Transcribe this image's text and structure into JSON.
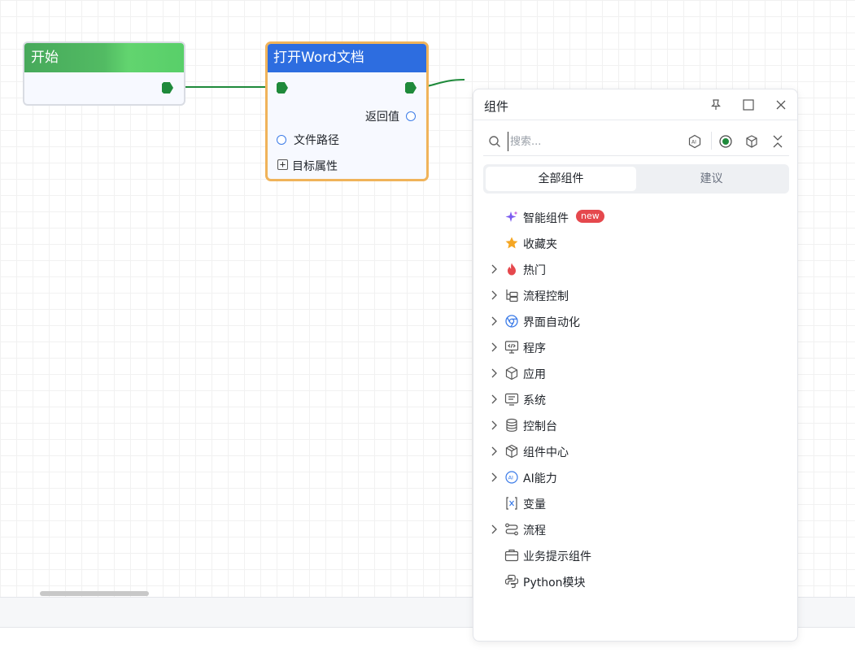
{
  "canvas": {
    "nodes": [
      {
        "title": "开始"
      },
      {
        "title": "打开Word文档",
        "output_label": "返回值",
        "input_label": "文件路径",
        "expand_label": "目标属性"
      }
    ]
  },
  "panel": {
    "title": "组件",
    "search": {
      "placeholder": "搜索..."
    },
    "tabs": [
      {
        "label": "全部组件",
        "active": true
      },
      {
        "label": "建议",
        "active": false
      }
    ],
    "tree": [
      {
        "label": "智能组件",
        "icon": "sparkle-icon",
        "expandable": false,
        "badge": "new"
      },
      {
        "label": "收藏夹",
        "icon": "star-icon",
        "expandable": false
      },
      {
        "label": "热门",
        "icon": "fire-icon",
        "expandable": true
      },
      {
        "label": "流程控制",
        "icon": "flow-control-icon",
        "expandable": true
      },
      {
        "label": "界面自动化",
        "icon": "browser-automation-icon",
        "expandable": true
      },
      {
        "label": "程序",
        "icon": "program-monitor-icon",
        "expandable": true
      },
      {
        "label": "应用",
        "icon": "cube-icon",
        "expandable": true
      },
      {
        "label": "系统",
        "icon": "system-icon",
        "expandable": true
      },
      {
        "label": "控制台",
        "icon": "database-icon",
        "expandable": true
      },
      {
        "label": "组件中心",
        "icon": "package-icon",
        "expandable": true
      },
      {
        "label": "AI能力",
        "icon": "ai-icon",
        "expandable": true
      },
      {
        "label": "变量",
        "icon": "variable-icon",
        "expandable": false
      },
      {
        "label": "流程",
        "icon": "process-icon",
        "expandable": true
      },
      {
        "label": "业务提示组件",
        "icon": "briefcase-icon",
        "expandable": false
      },
      {
        "label": "Python模块",
        "icon": "python-icon",
        "expandable": false
      }
    ]
  },
  "colors": {
    "start_header": "#52bb63",
    "open_header": "#2d6de0",
    "selected_border": "#f0b35a",
    "flow_port": "#1f8a3b",
    "badge": "#e5484d"
  }
}
